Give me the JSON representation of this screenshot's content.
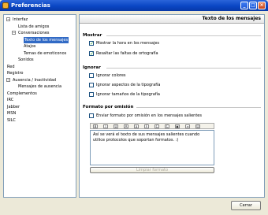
{
  "window": {
    "title": "Preferencias"
  },
  "tree": {
    "items": [
      {
        "label": "Interfaz",
        "indent": 0,
        "exp": "−"
      },
      {
        "label": "Lista de amigos",
        "indent": 2,
        "exp": ""
      },
      {
        "label": "Conversaciones",
        "indent": 1,
        "exp": "−"
      },
      {
        "label": "Texto de los mensajes",
        "indent": 3,
        "exp": "",
        "selected": true
      },
      {
        "label": "Atajos",
        "indent": 3,
        "exp": ""
      },
      {
        "label": "Temas de emoticonos",
        "indent": 3,
        "exp": ""
      },
      {
        "label": "Sonidos",
        "indent": 2,
        "exp": ""
      },
      {
        "label": "Red",
        "indent": 0,
        "exp": ""
      },
      {
        "label": "Registro",
        "indent": 0,
        "exp": ""
      },
      {
        "label": "Ausencia / Inactividad",
        "indent": 0,
        "exp": "−"
      },
      {
        "label": "Mensajes de ausencia",
        "indent": 2,
        "exp": ""
      },
      {
        "label": "Complementos",
        "indent": 0,
        "exp": ""
      },
      {
        "label": "IRC",
        "indent": 0,
        "exp": ""
      },
      {
        "label": "Jabber",
        "indent": 0,
        "exp": ""
      },
      {
        "label": "MSN",
        "indent": 0,
        "exp": ""
      },
      {
        "label": "SILC",
        "indent": 0,
        "exp": ""
      }
    ]
  },
  "panel": {
    "title": "Texto de los mensajes",
    "mostrar": {
      "heading": "Mostrar",
      "options": [
        {
          "label": "Mostrar la hora en los mensajes",
          "checked": true
        },
        {
          "label": "Resaltar las faltas de ortografía",
          "checked": true
        }
      ]
    },
    "ignorar": {
      "heading": "Ignorar",
      "options": [
        {
          "label": "Ignorar colores",
          "checked": false
        },
        {
          "label": "Ignorar aspectos de la tipografía",
          "checked": false
        },
        {
          "label": "Ignorar tamaños de la tipografía",
          "checked": false
        }
      ]
    },
    "formato": {
      "heading": "Formato por omisión",
      "option": {
        "label": "Enviar formato por omisión en los mensajes salientes",
        "checked": false
      },
      "preview_text": "Así se verá el texto de sus mensajes salientes cuando utilice protocolos que soportan formatos. :)",
      "clear_button": "Limpiar formato"
    }
  },
  "toolbar_icons": [
    "bold-icon",
    "italic-icon",
    "underline-icon",
    "font-size-larger-icon",
    "font-size-smaller-icon",
    "font-face-icon",
    "foreground-color-icon",
    "background-color-icon",
    "insert-image-icon",
    "insert-link-icon",
    "smiley-icon"
  ],
  "footer": {
    "close_button": "Cerrar"
  }
}
